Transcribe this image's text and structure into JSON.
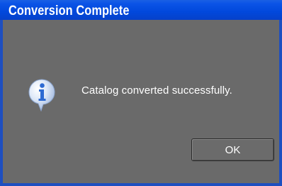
{
  "window": {
    "title": "Conversion Complete"
  },
  "dialog": {
    "icon": "info-icon",
    "message": "Catalog converted successfully.",
    "ok_label": "OK"
  },
  "colors": {
    "titlebar": "#0148dc",
    "body": "#6a6a6a",
    "icon": "#2d6ad2"
  }
}
